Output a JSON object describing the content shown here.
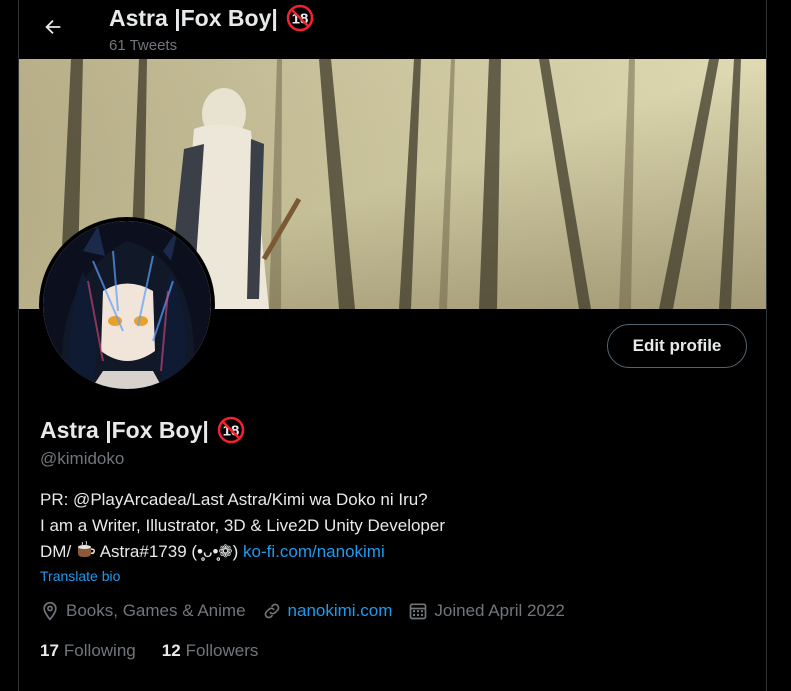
{
  "header": {
    "title": "Astra |Fox Boy|",
    "tweet_count": "61 Tweets"
  },
  "profile": {
    "name": "Astra |Fox Boy|",
    "handle": "@kimidoko",
    "edit_button": "Edit profile",
    "bio": {
      "line1": "PR: @PlayArcadea/Last Astra/Kimi wa Doko ni Iru?",
      "line2": "I am a Writer, Illustrator, 3D & Live2D Unity Developer",
      "line3_prefix": "DM/",
      "line3_middle": " Astra#1739 (•̥̥̥ᴗ•̥̥̥❁) ",
      "line3_link": "ko-fi.com/nanokimi"
    },
    "translate_bio": "Translate bio",
    "location": "Books, Games & Anime",
    "website": "nanokimi.com",
    "joined": "Joined April 2022",
    "following_count": "17",
    "following_label": "Following",
    "followers_count": "12",
    "followers_label": "Followers",
    "age_badge": "18"
  },
  "colors": {
    "background": "#000000",
    "text": "#e7e9ea",
    "muted": "#71767b",
    "link": "#1d9bf0",
    "badge_red": "#f4212e"
  },
  "icons": [
    "back-arrow-icon",
    "age-restricted-18-icon",
    "location-pin-icon",
    "link-icon",
    "calendar-icon",
    "coffee-cup-icon"
  ]
}
